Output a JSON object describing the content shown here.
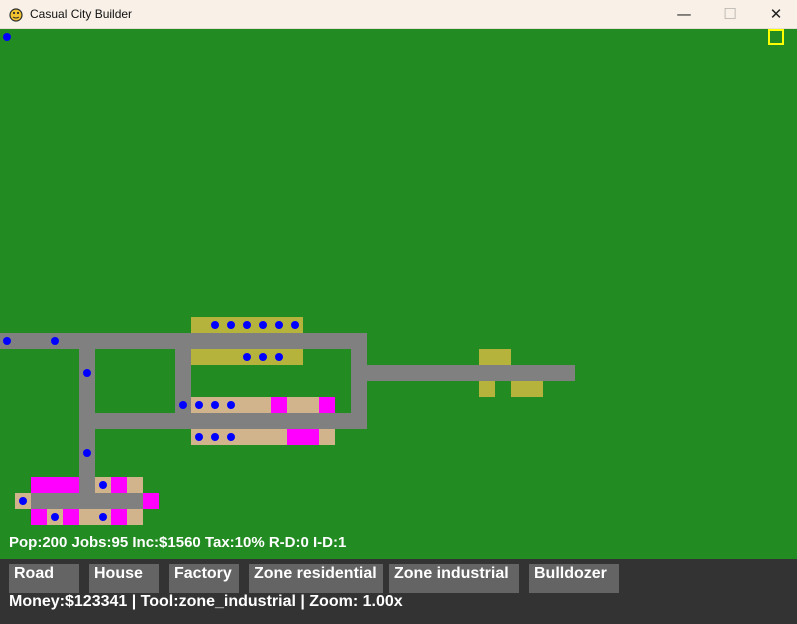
{
  "window": {
    "title": "Casual City Builder",
    "icon": "pygame-snake-icon",
    "controls": {
      "minimize": "—",
      "maximize": "☐",
      "close": "✕"
    }
  },
  "colors": {
    "grass": "#228b22",
    "road": "#808080",
    "residential_zone": "#d2b48c",
    "house": "#ff00ff",
    "industrial_zone": "#b5b33b",
    "citizen": "#0000ff",
    "selection": "#ffff00",
    "toolbar_bg": "#333333",
    "button_bg": "#646464"
  },
  "hud": {
    "stats": "Pop:200 Jobs:95 Inc:$1560 Tax:10% R-D:0 I-D:1"
  },
  "toolbar": {
    "buttons": [
      {
        "label": "Road"
      },
      {
        "label": "House"
      },
      {
        "label": "Factory"
      },
      {
        "label": "Zone residential"
      },
      {
        "label": "Zone industrial"
      },
      {
        "label": "Bulldozer"
      }
    ],
    "status": "Money:$123341 | Tool:zone_industrial | Zoom: 1.00x"
  }
}
